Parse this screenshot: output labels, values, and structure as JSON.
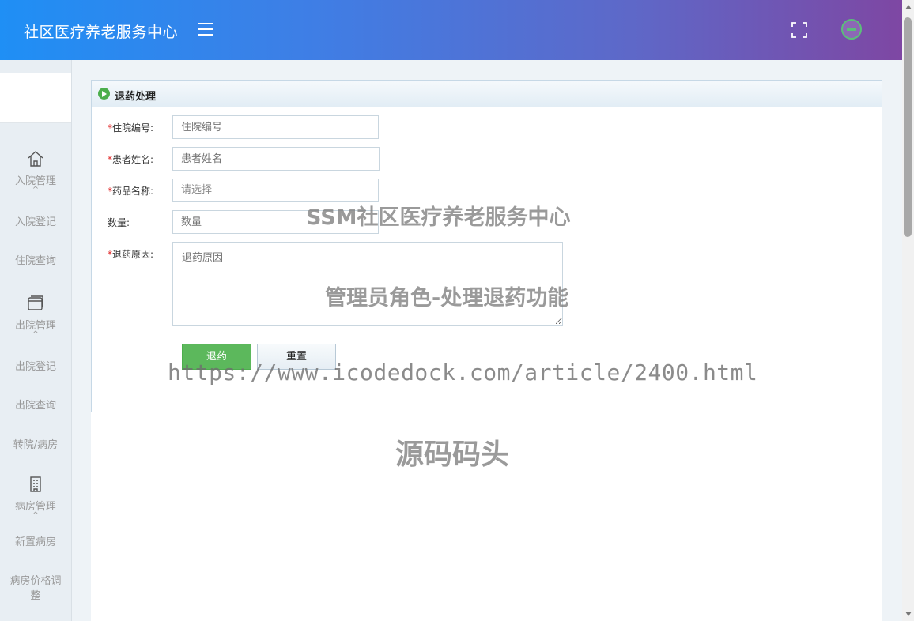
{
  "header": {
    "title": "社区医疗养老服务中心",
    "menu_icon": "hamburger-icon",
    "fullscreen_icon": "fullscreen-icon",
    "avatar_icon": "user-avatar"
  },
  "sidebar": {
    "groups": [
      {
        "label": "入院管理",
        "icon": "home-icon",
        "items": [
          "入院登记",
          "住院查询"
        ]
      },
      {
        "label": "出院管理",
        "icon": "window-icon",
        "items": [
          "出院登记",
          "出院查询",
          "转院/病房"
        ]
      },
      {
        "label": "病房管理",
        "icon": "building-icon",
        "items": [
          "新置病房",
          "病房价格调整"
        ]
      }
    ]
  },
  "panel": {
    "title": "退药处理",
    "fields": [
      {
        "label": "住院编号:",
        "required": true,
        "placeholder": "住院编号"
      },
      {
        "label": "患者姓名:",
        "required": true,
        "placeholder": "患者姓名"
      },
      {
        "label": "药品名称:",
        "required": true,
        "placeholder": "请选择"
      },
      {
        "label": "数量:",
        "required": false,
        "placeholder": "数量"
      },
      {
        "label": "退药原因:",
        "required": true,
        "placeholder": "退药原因"
      }
    ],
    "submit_label": "退药",
    "reset_label": "重置"
  },
  "watermarks": {
    "line1": "SSM社区医疗养老服务中心",
    "line2": "管理员角色-处理退药功能",
    "line3": "https://www.icodedock.com/article/2400.html",
    "line4": "源码码头"
  },
  "colors": {
    "header_gradient_start": "#1f8ff5",
    "header_gradient_end": "#7e47a3",
    "submit_button": "#5cb85c",
    "required_mark": "#e02020"
  }
}
